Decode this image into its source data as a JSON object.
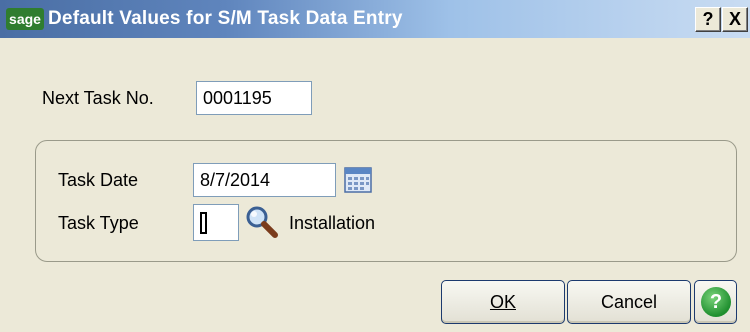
{
  "window": {
    "logo_text": "sage",
    "title": "Default Values for S/M Task Data Entry",
    "help_button": "?",
    "close_button": "X"
  },
  "form": {
    "next_task_label": "Next Task No.",
    "next_task_value": "0001195",
    "task_date_label": "Task Date",
    "task_date_value": "8/7/2014",
    "task_type_label": "Task Type",
    "task_type_value": "I",
    "task_type_description": "Installation"
  },
  "buttons": {
    "ok_label": "OK",
    "cancel_label": "Cancel",
    "help_label": "?"
  },
  "icons": {
    "calendar": "calendar-icon",
    "lookup": "magnifier-icon",
    "help": "help-circle-icon"
  },
  "colors": {
    "titlebar_start": "#4a6ea4",
    "titlebar_end": "#c9dcf2",
    "dialog_background": "#ece9d8",
    "help_green": "#1f8f2f"
  }
}
